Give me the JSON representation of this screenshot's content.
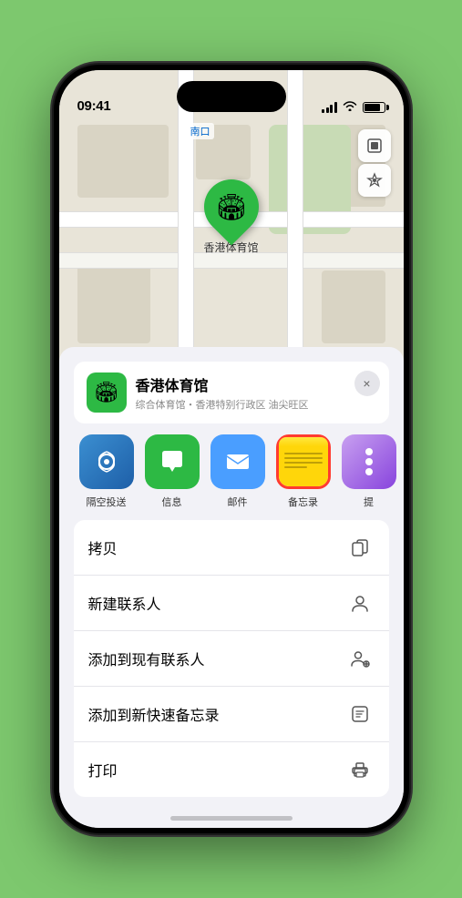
{
  "statusBar": {
    "time": "09:41",
    "hasSignal": true,
    "hasWifi": true,
    "hasBattery": true
  },
  "map": {
    "pinLabel": "香港体育馆",
    "northLabel": "南口",
    "controls": [
      "map-layers",
      "location"
    ]
  },
  "venueCard": {
    "name": "香港体育馆",
    "subtitle": "综合体育馆・香港特别行政区 油尖旺区",
    "closeLabel": "×"
  },
  "actions": [
    {
      "id": "airdrop",
      "label": "隔空投送",
      "icon": "airdrop"
    },
    {
      "id": "message",
      "label": "信息",
      "icon": "message"
    },
    {
      "id": "mail",
      "label": "邮件",
      "icon": "mail"
    },
    {
      "id": "notes",
      "label": "备忘录",
      "icon": "notes"
    },
    {
      "id": "more",
      "label": "提",
      "icon": "more"
    }
  ],
  "menuItems": [
    {
      "id": "copy",
      "label": "拷贝",
      "icon": "copy"
    },
    {
      "id": "new-contact",
      "label": "新建联系人",
      "icon": "person"
    },
    {
      "id": "add-to-contact",
      "label": "添加到现有联系人",
      "icon": "person-add"
    },
    {
      "id": "add-to-notes",
      "label": "添加到新快速备忘录",
      "icon": "quick-note"
    },
    {
      "id": "print",
      "label": "打印",
      "icon": "print"
    }
  ]
}
